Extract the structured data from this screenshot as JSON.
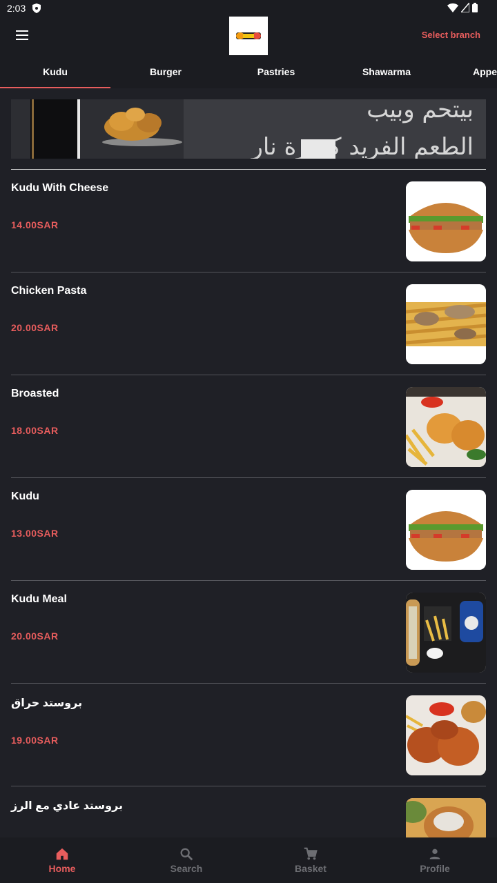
{
  "status": {
    "time": "2:03"
  },
  "header": {
    "select_branch": "Select branch"
  },
  "tabs": [
    {
      "label": "Kudu",
      "active": true
    },
    {
      "label": "Burger",
      "active": false
    },
    {
      "label": "Pastries",
      "active": false
    },
    {
      "label": "Shawarma",
      "active": false
    },
    {
      "label": "Appetizers",
      "active": false
    }
  ],
  "banner": {
    "text_line1": "بيتحم وبيب",
    "text_line2": "الطعم الفريد كسرة نار"
  },
  "items": [
    {
      "name": "Kudu With Cheese",
      "price": "14.00SAR",
      "image": "sandwich-image"
    },
    {
      "name": "Chicken Pasta",
      "price": "20.00SAR",
      "image": "pasta-image"
    },
    {
      "name": "Broasted",
      "price": "18.00SAR",
      "image": "fried-chicken-image"
    },
    {
      "name": "Kudu",
      "price": "13.00SAR",
      "image": "sandwich-image"
    },
    {
      "name": "Kudu Meal",
      "price": "20.00SAR",
      "image": "meal-image"
    },
    {
      "name": "بروستد حراق",
      "price": "19.00SAR",
      "image": "spicy-chicken-image"
    },
    {
      "name": "بروستد عادي مع الرز",
      "price": "",
      "image": "chicken-rice-image"
    }
  ],
  "bottom_nav": [
    {
      "label": "Home",
      "icon": "home-icon",
      "active": true
    },
    {
      "label": "Search",
      "icon": "search-icon",
      "active": false
    },
    {
      "label": "Basket",
      "icon": "cart-icon",
      "active": false
    },
    {
      "label": "Profile",
      "icon": "person-icon",
      "active": false
    }
  ],
  "colors": {
    "accent": "#e85d5d",
    "background": "#1f2026",
    "bar": "#1b1c21"
  }
}
